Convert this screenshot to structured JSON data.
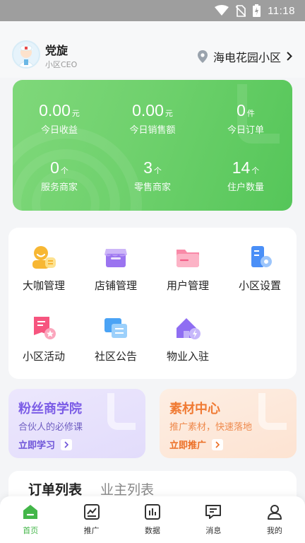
{
  "status_bar": {
    "time": "11:18"
  },
  "header": {
    "user_name": "党旋",
    "user_role": "小区CEO",
    "community": "海电花园小区"
  },
  "stats": [
    {
      "value": "0.00",
      "unit": "元",
      "label": "今日收益"
    },
    {
      "value": "0.00",
      "unit": "元",
      "label": "今日销售额"
    },
    {
      "value": "0",
      "unit": "件",
      "label": "今日订单"
    },
    {
      "value": "0",
      "unit": "个",
      "label": "服务商家"
    },
    {
      "value": "3",
      "unit": "个",
      "label": "零售商家"
    },
    {
      "value": "14",
      "unit": "个",
      "label": "住户数量"
    }
  ],
  "menu": [
    {
      "label": "大咖管理",
      "icon": "vip-manager-icon"
    },
    {
      "label": "店铺管理",
      "icon": "store-icon"
    },
    {
      "label": "用户管理",
      "icon": "user-folder-icon"
    },
    {
      "label": "小区设置",
      "icon": "community-settings-icon"
    },
    {
      "label": "小区活动",
      "icon": "activity-icon"
    },
    {
      "label": "社区公告",
      "icon": "announcement-icon"
    },
    {
      "label": "物业入驻",
      "icon": "property-home-icon"
    }
  ],
  "promos": [
    {
      "title": "粉丝商学院",
      "desc": "合伙人的必修课",
      "button": "立即学习"
    },
    {
      "title": "素材中心",
      "desc": "推广素材，快速落地",
      "button": "立即推广"
    }
  ],
  "list_tabs": [
    {
      "label": "订单列表"
    },
    {
      "label": "业主列表"
    }
  ],
  "nav": [
    {
      "label": "首页",
      "icon": "home-icon"
    },
    {
      "label": "推广",
      "icon": "promote-icon"
    },
    {
      "label": "数据",
      "icon": "data-icon"
    },
    {
      "label": "消息",
      "icon": "message-icon"
    },
    {
      "label": "我的",
      "icon": "profile-icon"
    }
  ],
  "colors": {
    "accent_green": "#55c659",
    "promo_purple": "#7b5ce6",
    "promo_orange": "#f07a33"
  }
}
